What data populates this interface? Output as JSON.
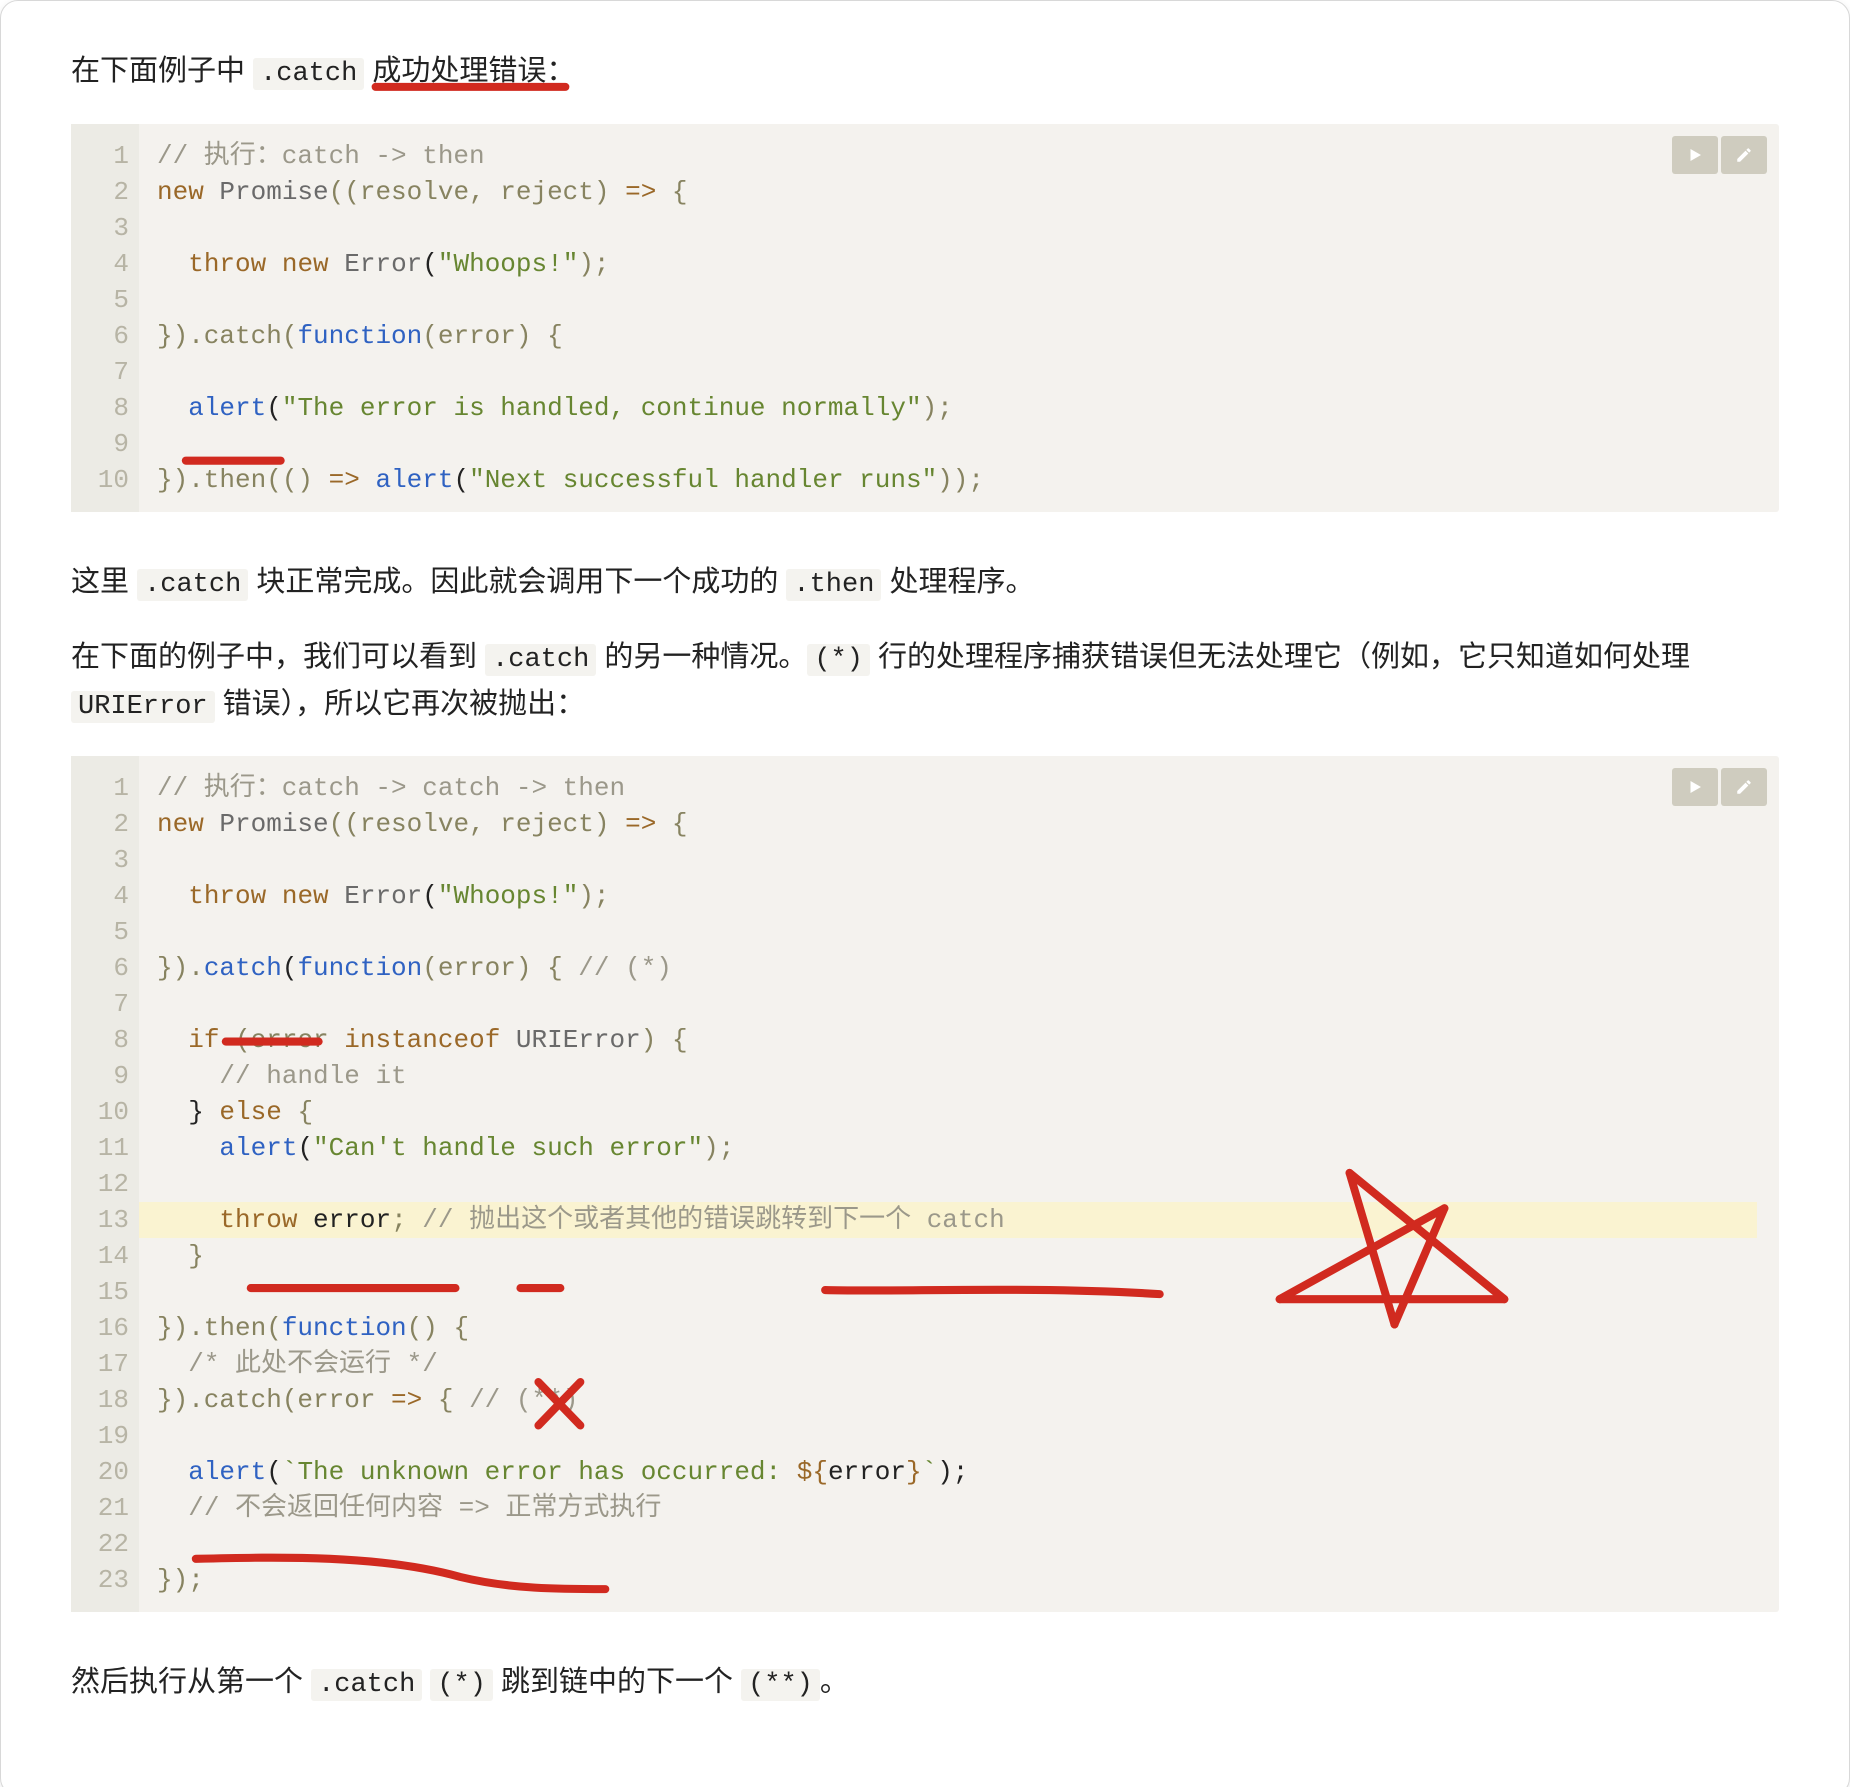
{
  "para1": {
    "pre": "在下面例子中 ",
    "code1": ".catch",
    "post": " 成功处理错误："
  },
  "para2": {
    "t0": "这里 ",
    "c1": ".catch",
    "t1": " 块正常完成。因此就会调用下一个成功的 ",
    "c2": ".then",
    "t2": " 处理程序。"
  },
  "para3": {
    "t0": "在下面的例子中，我们可以看到 ",
    "c1": ".catch",
    "t1": " 的另一种情况。",
    "c2": "(*)",
    "t2": " 行的处理程序捕获错误但无法处理它（例如，它只知道如何处理 ",
    "c3": "URIError",
    "t3": " 错误），所以它再次被抛出："
  },
  "para4": {
    "t0": "然后执行从第一个 ",
    "c1": ".catch",
    "t1": " ",
    "c2": "(*)",
    "t2": " 跳到链中的下一个 ",
    "c3": "(**)",
    "t3": "。"
  },
  "code1": {
    "lines": 10,
    "c1": "// 执行：catch -> then",
    "kw_new": "new",
    "cls_Promise": "Promise",
    "arg1": "((resolve, reject) ",
    "arrow": "=>",
    "obr": " {",
    "kw_throw": "throw",
    "kw_new2": "new",
    "cls_Error": "Error",
    "str_whoops": "\"Whoops!\"",
    "cbr_sc": ");",
    "catch_prefix": "}).catch(",
    "kw_function": "function",
    "fn_args": "(error) {",
    "fn_alert": "alert",
    "str_handled": "\"The error is handled, continue normally\"",
    "rp_sc": ");",
    "then_prefix": "}).then(() ",
    "fn_alert2": "alert",
    "str_next": "\"Next successful handler runs\"",
    "tail": "));"
  },
  "code2": {
    "lines": 23,
    "c1": "// 执行：catch -> catch -> then",
    "kw_new": "new",
    "cls_Promise": "Promise",
    "arg1": "((resolve, reject) ",
    "arrow": "=>",
    "obr": " {",
    "kw_throw": "throw",
    "kw_new2": "new",
    "cls_Error": "Error",
    "str_whoops": "\"Whoops!\"",
    "cbr_sc": ");",
    "catch_prefix": "}).",
    "catch_word": "catch",
    "kw_function": "function",
    "fn_args": "(error) { ",
    "cm_star": "// (*)",
    "kw_if": "if",
    "if_args": " (error ",
    "kw_instanceof": "instanceof",
    "cls_URIError": "URIError",
    "if_close": ") {",
    "cm_handle": "// handle it",
    "kw_else": "else",
    "else_open": " {",
    "fn_alert": "alert",
    "str_cant": "\"Can't handle such error\"",
    "rp_sc": ");",
    "kw_throw2": "throw",
    "id_error": "error",
    "sc": ";",
    "cm_rethrow": "// 抛出这个或者其他的错误跳转到下一个 catch",
    "close_brace": "}",
    "then_prefix": "}).then(",
    "kw_function2": "function",
    "then_args": "() {",
    "cm_notrun": "/* 此处不会运行 */",
    "catch2_prefix": "}).catch(error ",
    "arrow2": "=>",
    "catch2_args": " { ",
    "cm_star2": "// (**)",
    "fn_alert2": "alert",
    "tpl_open": "`",
    "tpl_text": "The unknown error has occurred: ",
    "tpl_expr_open": "${",
    "tpl_expr": "error",
    "tpl_expr_close": "}",
    "tpl_close": "`",
    "cm_noreturn": "// 不会返回任何内容 => 正常方式执行",
    "end": "});"
  },
  "ctl": {
    "run_title": "run",
    "edit_title": "edit"
  }
}
